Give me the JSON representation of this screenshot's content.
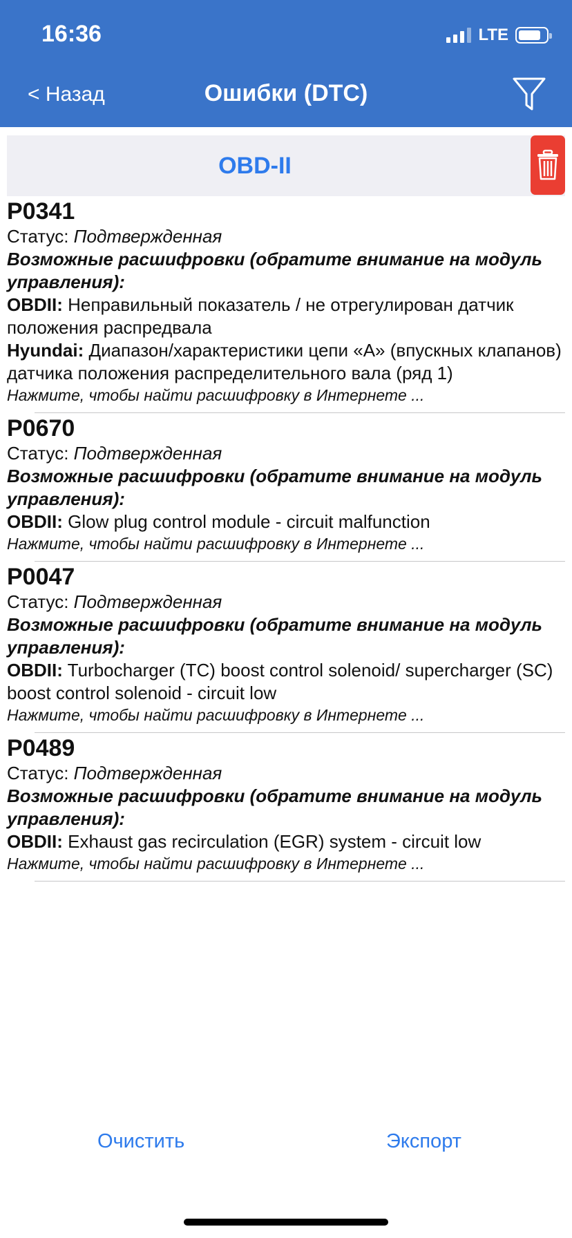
{
  "status_bar": {
    "time": "16:36",
    "network": "LTE"
  },
  "nav": {
    "back_label": "< Назад",
    "title": "Ошибки (DTC)"
  },
  "section": {
    "title": "OBD-II"
  },
  "errors": [
    {
      "code": "P0341",
      "status_label": "Статус:",
      "status_value": "Подтвержденная",
      "decode_title": "Возможные расшифровки (обратите внимание на модуль управления):",
      "decodes": [
        {
          "source": "OBDII:",
          "text": "Неправильный показатель / не отрегулирован датчик положения распредвала"
        },
        {
          "source": "Hyundai:",
          "text": "Диапазон/характеристики цепи «A» (впускных клапанов) датчика положения распределительного вала (ряд 1)"
        }
      ],
      "hint": "Нажмите, чтобы найти расшифровку в Интернете ..."
    },
    {
      "code": "P0670",
      "status_label": "Статус:",
      "status_value": "Подтвержденная",
      "decode_title": "Возможные расшифровки (обратите внимание на модуль управления):",
      "decodes": [
        {
          "source": "OBDII:",
          "text": "Glow plug control module - circuit malfunction"
        }
      ],
      "hint": "Нажмите, чтобы найти расшифровку в Интернете ..."
    },
    {
      "code": "P0047",
      "status_label": "Статус:",
      "status_value": "Подтвержденная",
      "decode_title": "Возможные расшифровки (обратите внимание на модуль управления):",
      "decodes": [
        {
          "source": "OBDII:",
          "text": "Turbocharger (TC) boost control solenoid/ supercharger (SC) boost control solenoid - circuit low"
        }
      ],
      "hint": "Нажмите, чтобы найти расшифровку в Интернете ..."
    },
    {
      "code": "P0489",
      "status_label": "Статус:",
      "status_value": "Подтвержденная",
      "decode_title": "Возможные расшифровки (обратите внимание на модуль управления):",
      "decodes": [
        {
          "source": "OBDII:",
          "text": "Exhaust gas recirculation (EGR) system - circuit low"
        }
      ],
      "hint": "Нажмите, чтобы найти расшифровку в Интернете ..."
    }
  ],
  "footer": {
    "clear_label": "Очистить",
    "export_label": "Экспорт"
  },
  "colors": {
    "header_bg": "#3a74c9",
    "accent": "#2e7bec",
    "delete": "#ea3e32"
  },
  "icons": {
    "filter": "filter-icon",
    "delete": "trash-icon",
    "back": "chevron-left"
  }
}
